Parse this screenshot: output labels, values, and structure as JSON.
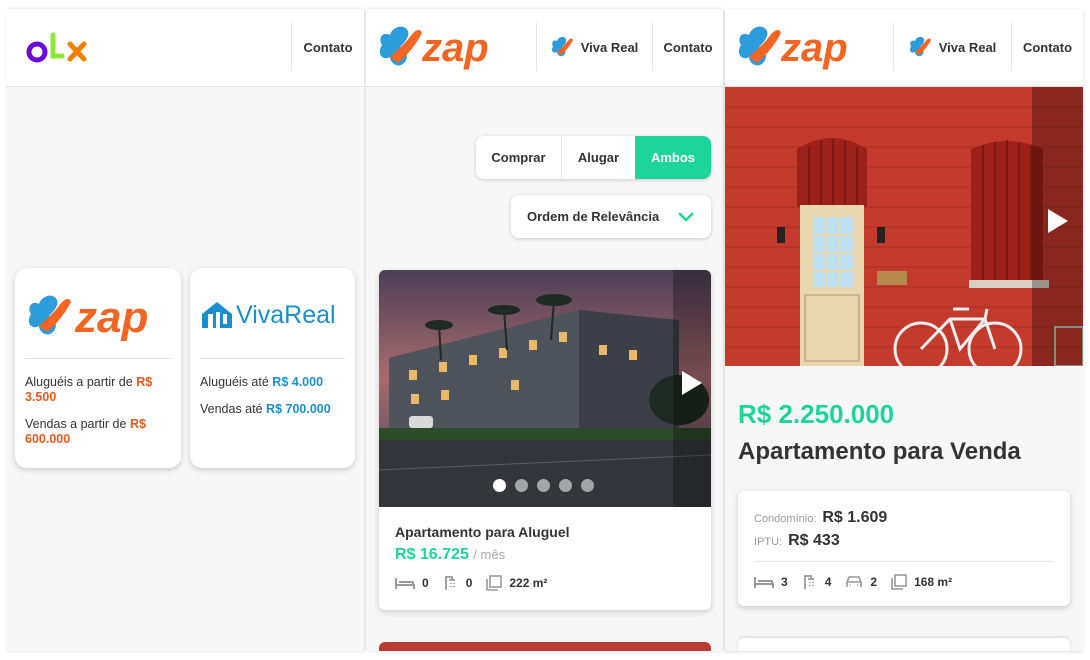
{
  "screen1": {
    "header": {
      "logo": "OLX",
      "nav_contact": "Contato"
    },
    "brands": [
      {
        "name": "zap",
        "line1_label": "Aluguéis a partir de",
        "line1_value_a": "R$",
        "line1_value_b": "3.500",
        "line2_label": "Vendas a partir de",
        "line2_value_a": "R$",
        "line2_value_b": "600.000"
      },
      {
        "name": "VivaReal",
        "line1_label": "Aluguéis até",
        "line1_value": "R$ 4.000",
        "line2_label": "Vendas até",
        "line2_value": "R$ 700.000"
      }
    ]
  },
  "screen2": {
    "header": {
      "logo": "zap",
      "nav_vivareal": "Viva Real",
      "nav_contact": "Contato"
    },
    "segment": {
      "options": [
        "Comprar",
        "Alugar",
        "Ambos"
      ],
      "selected": "Ambos"
    },
    "sort": {
      "label": "Ordem de Relevância"
    },
    "listing": {
      "title": "Apartamento para Aluguel",
      "price": "R$ 16.725",
      "price_suffix": "/ mês",
      "bedrooms": "0",
      "bathrooms": "0",
      "area": "222 m²",
      "carousel_dots": 5,
      "carousel_active": 1
    }
  },
  "screen3": {
    "header": {
      "logo": "zap",
      "nav_vivareal": "Viva Real",
      "nav_contact": "Contato"
    },
    "detail": {
      "price": "R$ 2.250.000",
      "title": "Apartamento para Venda",
      "condo_label": "Condomínio:",
      "condo_value": "R$ 1.609",
      "iptu_label": "IPTU:",
      "iptu_value": "R$ 433",
      "bedrooms": "3",
      "bathrooms": "4",
      "parking": "2",
      "area": "168 m²"
    }
  },
  "colors": {
    "zap_orange": "#f26522",
    "zap_blue": "#2d9cdb",
    "green": "#1dd59b",
    "olx_purple": "#6e0ad6"
  }
}
